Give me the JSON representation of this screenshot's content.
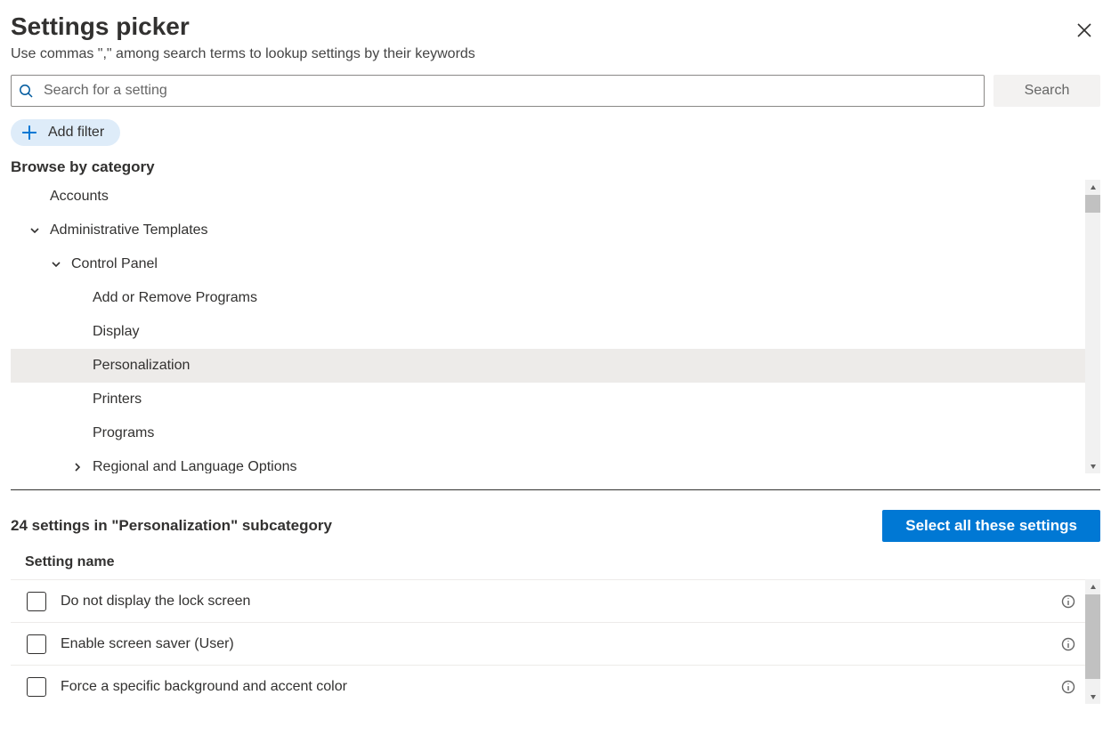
{
  "header": {
    "title": "Settings picker",
    "subtitle": "Use commas \",\" among search terms to lookup settings by their keywords"
  },
  "search": {
    "placeholder": "Search for a setting",
    "button_label": "Search"
  },
  "add_filter_label": "Add filter",
  "browse_heading": "Browse by category",
  "tree": {
    "items": [
      {
        "label": "Accounts",
        "level": 0,
        "chevron": "none",
        "selected": false
      },
      {
        "label": "Administrative Templates",
        "level": 0,
        "chevron": "down",
        "selected": false
      },
      {
        "label": "Control Panel",
        "level": 1,
        "chevron": "down",
        "selected": false
      },
      {
        "label": "Add or Remove Programs",
        "level": 2,
        "chevron": "none",
        "selected": false
      },
      {
        "label": "Display",
        "level": 2,
        "chevron": "none",
        "selected": false
      },
      {
        "label": "Personalization",
        "level": 2,
        "chevron": "none",
        "selected": true
      },
      {
        "label": "Printers",
        "level": 2,
        "chevron": "none",
        "selected": false
      },
      {
        "label": "Programs",
        "level": 2,
        "chevron": "none",
        "selected": false
      },
      {
        "label": "Regional and Language Options",
        "level": 2,
        "chevron": "right",
        "selected": false
      }
    ]
  },
  "results": {
    "heading": "24 settings in \"Personalization\" subcategory",
    "select_all_label": "Select all these settings",
    "column_header": "Setting name",
    "rows": [
      {
        "label": "Do not display the lock screen"
      },
      {
        "label": "Enable screen saver (User)"
      },
      {
        "label": "Force a specific background and accent color"
      }
    ]
  }
}
